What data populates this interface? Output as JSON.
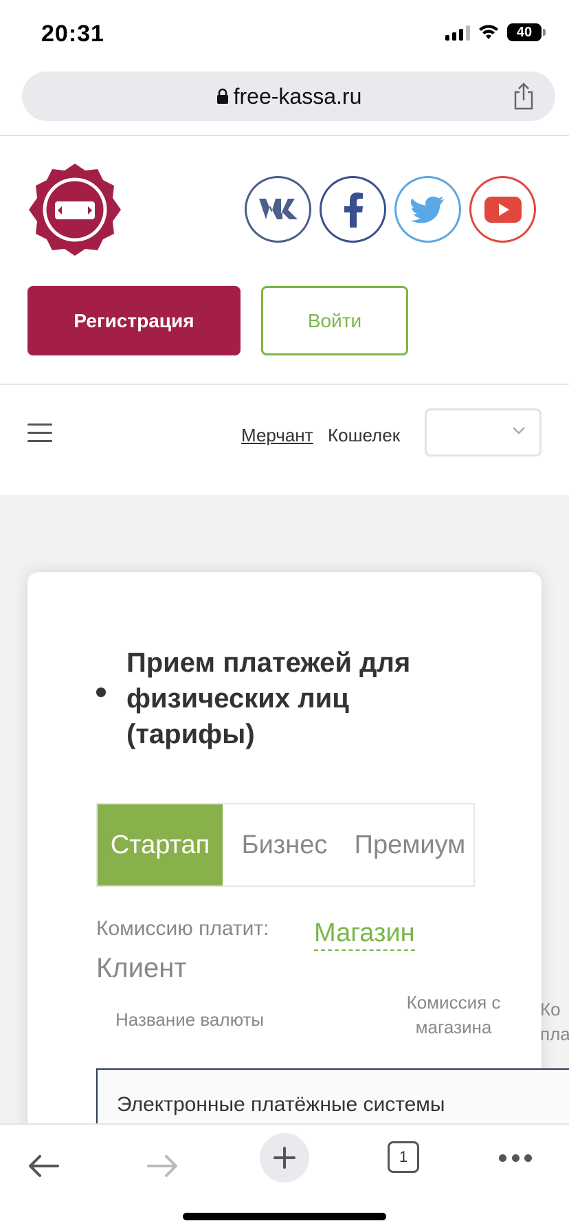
{
  "status": {
    "time": "20:31",
    "battery": "40"
  },
  "browser": {
    "url": "free-kassa.ru",
    "tab_count": "1"
  },
  "header": {
    "register_label": "Регистрация",
    "login_label": "Войти",
    "socials": [
      "vk-icon",
      "facebook-icon",
      "twitter-icon",
      "youtube-icon"
    ],
    "brand_color": "#a31f46",
    "accent_color": "#7ab648"
  },
  "nav": {
    "merchant": "Мерчант",
    "wallet": "Кошелек",
    "language_value": ""
  },
  "card": {
    "heading": "Прием платежей для физических лиц (тарифы)",
    "tabs": [
      {
        "label": "Стартап",
        "active": true
      },
      {
        "label": "Бизнес",
        "active": false
      },
      {
        "label": "Премиум",
        "active": false
      }
    ],
    "fee_payer_label": "Комиссию платит:",
    "fee_payer_shop": "Магазин",
    "fee_payer_client": "Клиент",
    "columns": {
      "currency": "Название валюты",
      "shop_fee": "Комиссия с магазина",
      "client_fee": "Ко\nпла"
    },
    "section": "Электронные платёжные системы"
  }
}
